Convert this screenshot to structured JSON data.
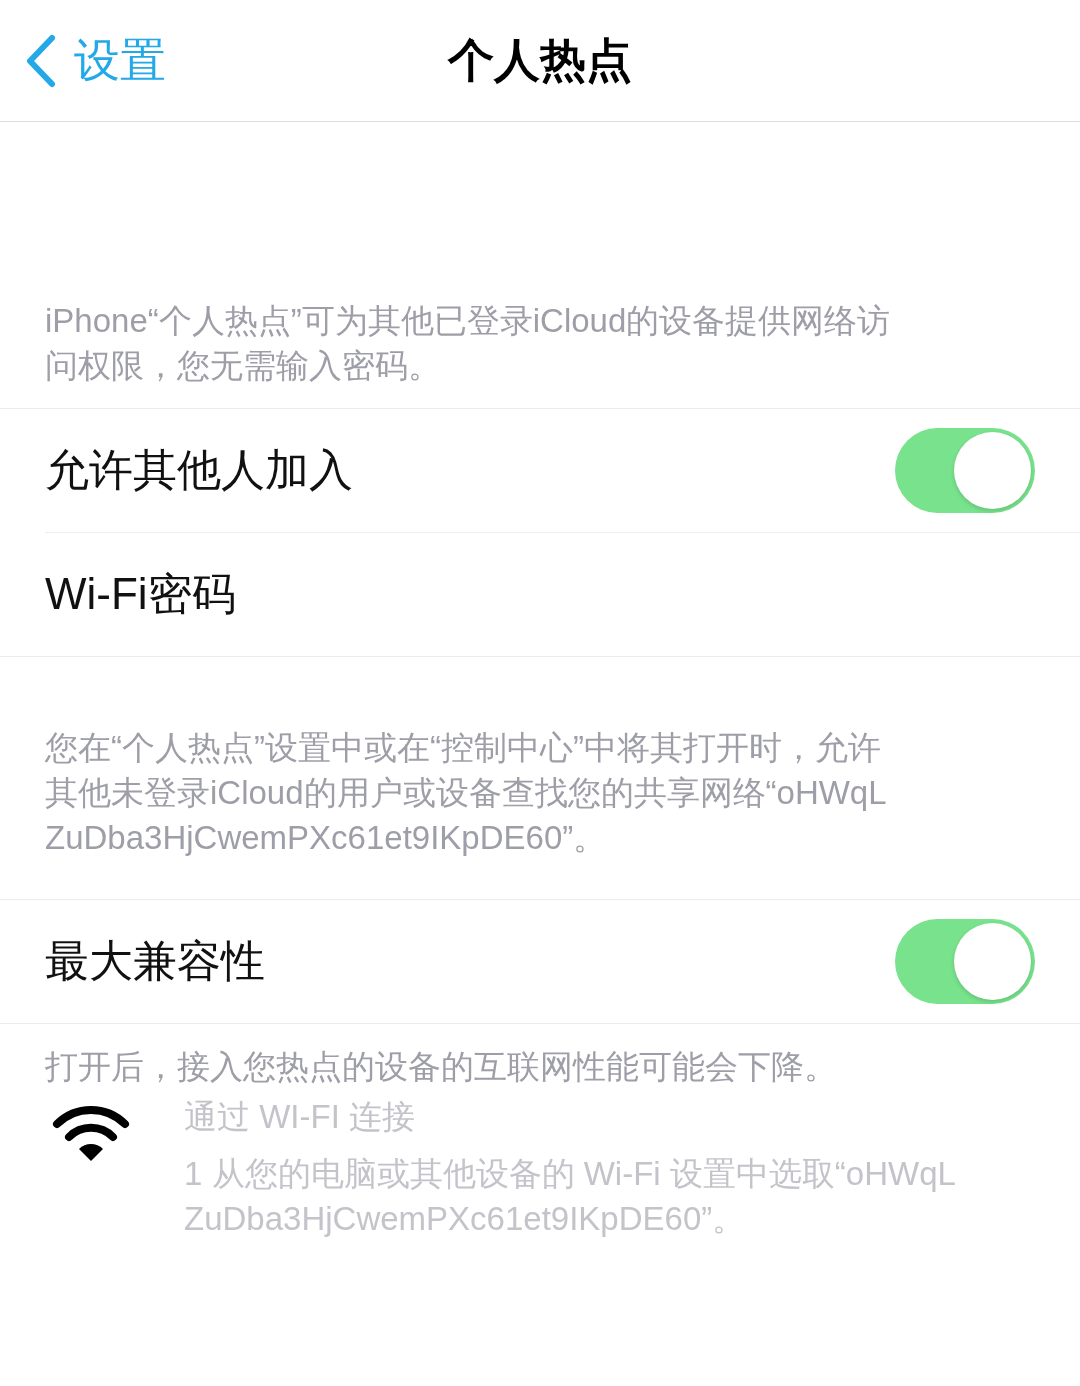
{
  "nav": {
    "back_label": "设置",
    "title": "个人热点"
  },
  "intro": {
    "lines": [
      "iPhone“个人热点”可为其他已登录iCloud的设备提供网络访",
      "问权限，您无需输入密码。"
    ]
  },
  "group_1": [
    {
      "kind": "toggle",
      "label": "允许其他人加入",
      "on": true
    },
    {
      "kind": "link",
      "label": "Wi-Fi密码"
    }
  ],
  "group_1_footer": {
    "lines": [
      "您在“个人热点”设置中或在“控制中心”中将其打开时，允许",
      "其他未登录iCloud的用户或设备查找您的共享网络“oHWqL",
      "ZuDba3HjCwemPXc61et9IKpDE60”。"
    ]
  },
  "group_2": [
    {
      "kind": "toggle",
      "label": "最大兼容性",
      "on": true
    }
  ],
  "group_2_footer": {
    "lines": [
      "打开后，接入您热点的设备的互联网性能可能会下降。"
    ]
  },
  "wifi_help": {
    "title": "通过 WI-FI 连接",
    "lines": [
      "1 从您的电脑或其他设备的 Wi-Fi 设置中选取“oHWqL",
      "ZuDba3HjCwemPXc61et9IKpDE60”。"
    ]
  }
}
